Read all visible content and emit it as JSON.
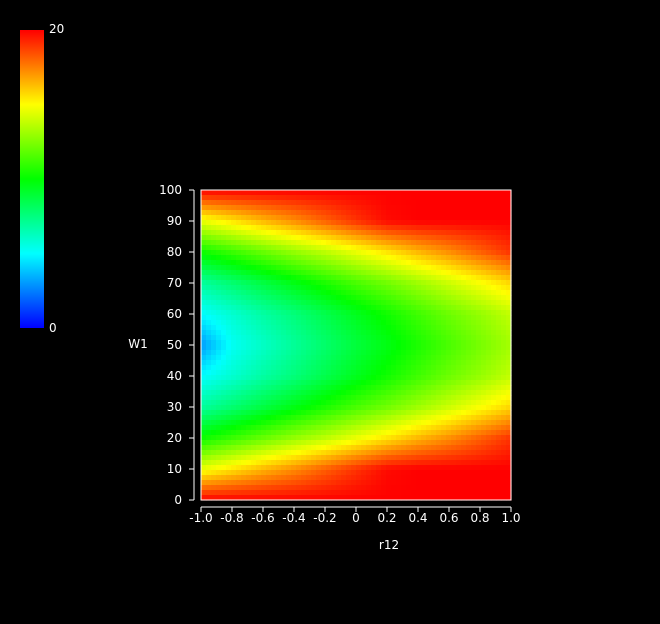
{
  "chart_data": {
    "type": "heatmap",
    "title": "",
    "xlabel": "r12",
    "ylabel": "W1",
    "xlim": [
      -1.0,
      1.0
    ],
    "ylim": [
      0,
      100
    ],
    "x_ticks": [
      "-1.0",
      "-0.8",
      "-0.6",
      "-0.4",
      "-0.2",
      "0",
      "0.2",
      "0.4",
      "0.6",
      "0.8",
      "1.0"
    ],
    "y_ticks": [
      "0",
      "10",
      "20",
      "30",
      "40",
      "50",
      "60",
      "70",
      "80",
      "90",
      "100"
    ],
    "colorbar": {
      "min_label": "0",
      "max_label": "20",
      "range": [
        0,
        20
      ],
      "colors": [
        "#0000ff",
        "#00ffff",
        "#00ff00",
        "#ffff00",
        "#ff0000"
      ]
    },
    "x": [
      -1.0,
      -0.8,
      -0.6,
      -0.4,
      -0.2,
      0.0,
      0.2,
      0.4,
      0.6,
      0.8,
      1.0
    ],
    "y": [
      0,
      10,
      20,
      30,
      40,
      50,
      60,
      70,
      80,
      90,
      100
    ],
    "z": [
      [
        20.0,
        20.0,
        20.0,
        20.0,
        20.0,
        20.0,
        20.0,
        20.0,
        20.0,
        20.0,
        20.0
      ],
      [
        14.6,
        15.5,
        16.4,
        17.2,
        18.1,
        19.0,
        19.8,
        20.0,
        20.0,
        20.0,
        20.0
      ],
      [
        10.2,
        11.1,
        12.0,
        12.9,
        13.7,
        14.6,
        15.5,
        16.4,
        17.2,
        18.1,
        19.0
      ],
      [
        6.9,
        7.8,
        8.7,
        9.6,
        10.5,
        11.4,
        12.2,
        13.1,
        14.0,
        14.9,
        15.8
      ],
      [
        5.0,
        5.9,
        6.8,
        7.6,
        8.5,
        9.4,
        10.3,
        11.2,
        12.1,
        12.9,
        13.8
      ],
      [
        3.0,
        5.2,
        6.1,
        7.0,
        7.9,
        8.8,
        9.6,
        10.5,
        11.4,
        12.3,
        13.2
      ],
      [
        5.0,
        5.9,
        6.8,
        7.6,
        8.5,
        9.4,
        10.3,
        11.2,
        12.1,
        12.9,
        13.8
      ],
      [
        6.9,
        7.8,
        8.7,
        9.6,
        10.5,
        11.4,
        12.2,
        13.1,
        14.0,
        14.9,
        15.8
      ],
      [
        10.2,
        11.1,
        12.0,
        12.9,
        13.7,
        14.6,
        15.5,
        16.4,
        17.2,
        18.1,
        19.0
      ],
      [
        14.6,
        15.5,
        16.4,
        17.2,
        18.1,
        19.0,
        19.8,
        20.0,
        20.0,
        20.0,
        20.0
      ],
      [
        20.0,
        20.0,
        20.0,
        20.0,
        20.0,
        20.0,
        20.0,
        20.0,
        20.0,
        20.0,
        20.0
      ]
    ]
  }
}
